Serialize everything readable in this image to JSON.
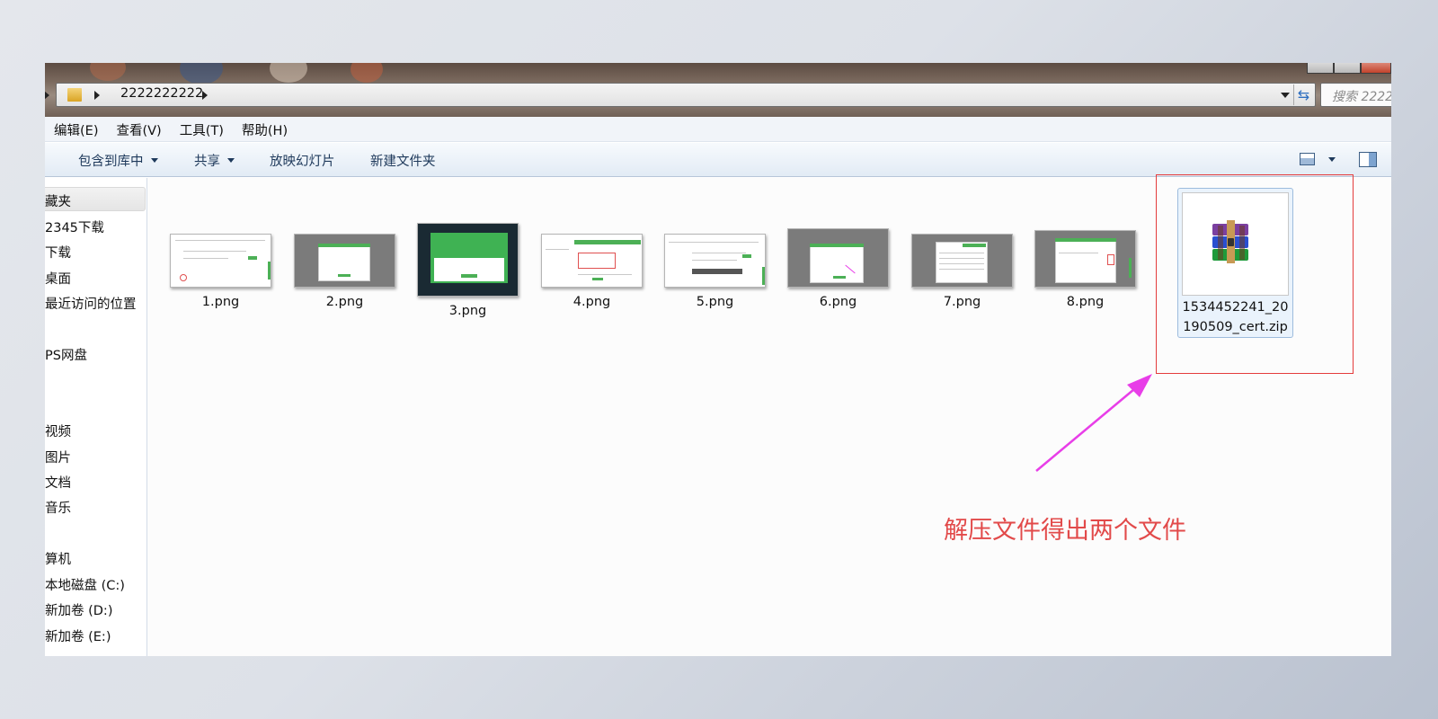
{
  "window": {
    "address_path": "2222222222",
    "search_placeholder": "搜索 2222"
  },
  "menu": [
    "编辑(E)",
    "查看(V)",
    "工具(T)",
    "帮助(H)"
  ],
  "commands": {
    "include_library": "包含到库中",
    "share": "共享",
    "slideshow": "放映幻灯片",
    "new_folder": "新建文件夹"
  },
  "nav": {
    "items": [
      "藏夹",
      "2345下载",
      "下载",
      "桌面",
      "最近访问的位置",
      "PS网盘",
      "视频",
      "图片",
      "文档",
      "音乐",
      "算机",
      "本地磁盘 (C:)",
      "新加卷 (D:)",
      "新加卷 (E:)"
    ]
  },
  "files": [
    {
      "name": "1.png"
    },
    {
      "name": "2.png"
    },
    {
      "name": "3.png"
    },
    {
      "name": "4.png"
    },
    {
      "name": "5.png"
    },
    {
      "name": "6.png"
    },
    {
      "name": "7.png"
    },
    {
      "name": "8.png"
    }
  ],
  "zip_file": {
    "name_line1": "1534452241_20",
    "name_line2": "190509_cert.zip",
    "icon": "winrar-archive-icon"
  },
  "annotation": {
    "text": "解压文件得出两个文件",
    "color": "#e24a4a",
    "arrow_color": "#e83ee8",
    "box_color": "#e43c3c"
  }
}
